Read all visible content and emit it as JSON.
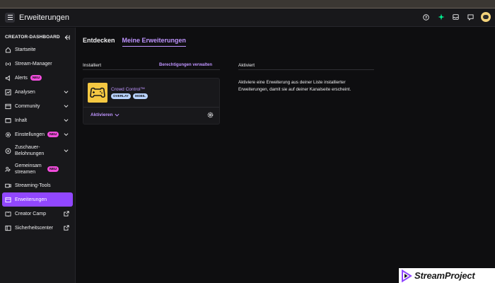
{
  "header": {
    "title": "Erweiterungen"
  },
  "sidebar": {
    "heading": "CREATOR-DASHBOARD",
    "items": [
      {
        "label": "Startseite"
      },
      {
        "label": "Stream-Manager"
      },
      {
        "label": "Alerts",
        "badge": "NEU"
      },
      {
        "label": "Analysen"
      },
      {
        "label": "Community"
      },
      {
        "label": "Inhalt"
      },
      {
        "label": "Einstellungen",
        "badge": "NEU"
      },
      {
        "label": "Zuschauer-Belohnungen"
      },
      {
        "label": "Gemeinsam streamen",
        "badge": "NEU"
      },
      {
        "label": "Streaming-Tools"
      },
      {
        "label": "Erweiterungen"
      },
      {
        "label": "Creator Camp"
      },
      {
        "label": "Sicherheitscenter"
      }
    ]
  },
  "tabs": [
    {
      "label": "Entdecken"
    },
    {
      "label": "Meine Erweiterungen"
    }
  ],
  "installed": {
    "heading": "Installiert",
    "manage_link": "Berechtigungen verwalten",
    "extension": {
      "name": "Crowd Control™",
      "tags": [
        "OVERLAY",
        "MOBIL"
      ],
      "activate_label": "Aktivieren"
    }
  },
  "activated": {
    "heading": "Aktiviert",
    "description": "Aktiviere eine Erweiterung aus deiner Liste installierter Erweiterungen, damit sie auf deiner Kanalseite erscheint."
  },
  "watermark": {
    "text": "StreamProject"
  },
  "colors": {
    "accent": "#9147ff",
    "accent_text": "#bf94ff",
    "badge": "#f04cdb",
    "tag": "#b9d3fd",
    "background": "#0e0e10",
    "panel": "#18181b"
  }
}
